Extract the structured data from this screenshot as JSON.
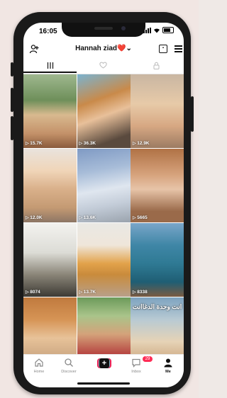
{
  "status": {
    "time": "16:05"
  },
  "header": {
    "username": "Hannah ziad",
    "heart": "❤️",
    "dropdown": "⌄"
  },
  "tabs": [
    {
      "icon": "grid-icon",
      "active": true
    },
    {
      "icon": "liked-heart-icon",
      "active": false
    },
    {
      "icon": "lock-icon",
      "active": false
    }
  ],
  "videos": [
    {
      "views": "15.7K"
    },
    {
      "views": "36.3K"
    },
    {
      "views": "12.9K"
    },
    {
      "views": "12.0K"
    },
    {
      "views": "13.6K"
    },
    {
      "views": "5665"
    },
    {
      "views": "8074"
    },
    {
      "views": "13.7K"
    },
    {
      "views": "8338"
    },
    {
      "views": ""
    },
    {
      "views": ""
    },
    {
      "views": "",
      "caption": "انت وحدة الدغاانت"
    }
  ],
  "nav": {
    "home": "Home",
    "discover": "Discover",
    "create": "+",
    "inbox": "Inbox",
    "inbox_badge": "29",
    "me": "Me"
  }
}
